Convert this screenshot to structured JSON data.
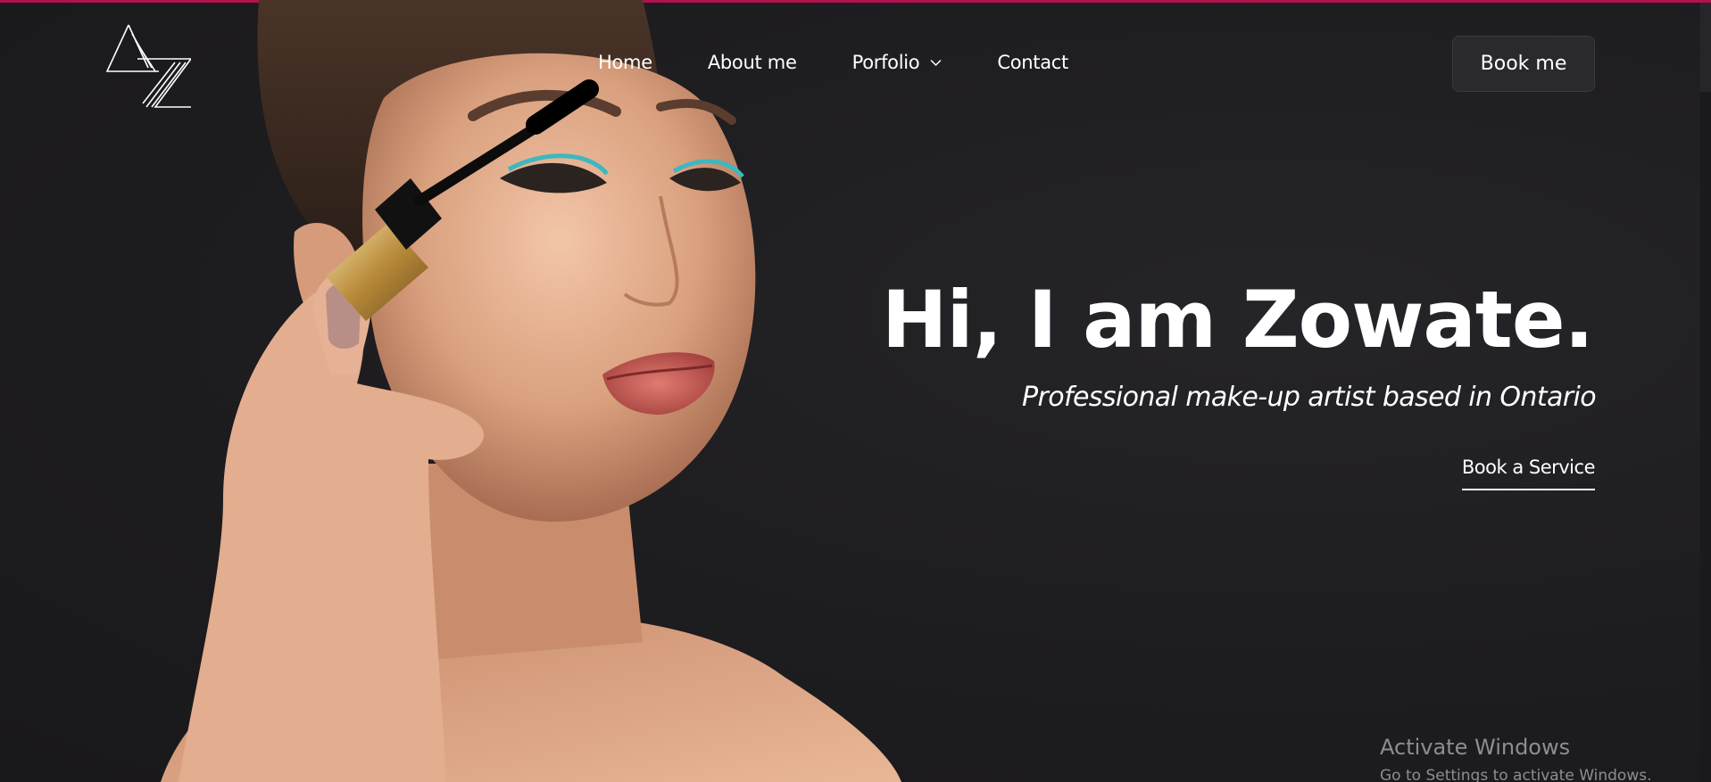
{
  "colors": {
    "accent_bar": "#b0124f",
    "background": "#1c1b1e",
    "text": "#ffffff",
    "button_bg": "#2a2a2d"
  },
  "header": {
    "logo_icon": "az-monogram-logo",
    "nav": [
      {
        "label": "Home"
      },
      {
        "label": "About me"
      },
      {
        "label": "Porfolio",
        "icon": "chevron-down-icon"
      },
      {
        "label": "Contact"
      }
    ],
    "book_label": "Book me"
  },
  "hero": {
    "image": "portrait-mascara-photo",
    "title": "Hi, I am Zowate.",
    "subtitle": "Professional make-up artist based in Ontario",
    "cta_label": "Book a Service"
  },
  "os_overlay": {
    "line1": "Activate Windows",
    "line2": "Go to Settings to activate Windows."
  }
}
